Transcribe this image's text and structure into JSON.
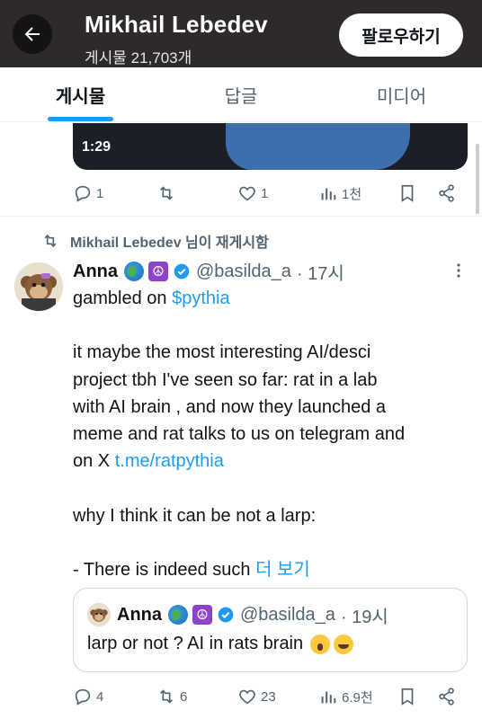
{
  "header": {
    "back_icon": "arrow-left-icon",
    "name": "Mikhail Lebedev",
    "post_count": "게시물 21,703개",
    "follow_label": "팔로우하기"
  },
  "tabs": [
    {
      "label": "게시물",
      "active": true
    },
    {
      "label": "답글",
      "active": false
    },
    {
      "label": "미디어",
      "active": false
    }
  ],
  "prev_post": {
    "video_duration": "1:29",
    "actions": {
      "replies": "1",
      "reposts": "",
      "likes": "1",
      "views": "1천"
    }
  },
  "repost_label": "Mikhail Lebedev 님이 재게시함",
  "tweet": {
    "author": "Anna",
    "author_emojis": [
      "globe-icon",
      "peace-icon"
    ],
    "handle": "@basilda_a",
    "time": "· 17시",
    "lines": {
      "l1_text": "gambled on ",
      "l1_link": "$pythia",
      "l2": "it maybe the most interesting AI/desci",
      "l3": "project tbh I've seen so far: rat in a lab",
      "l4": "with AI brain , and now they launched a",
      "l5": "meme and  rat talks to us on telegram and",
      "l6_text": "on X ",
      "l6_link": "t.me/ratpythia",
      "l7": "why I think it can be not a larp:",
      "l8_text": "- There is indeed such ",
      "l8_more": "더 보기"
    },
    "quote": {
      "author": "Anna",
      "handle": "@basilda_a",
      "time": "· 19시",
      "text": "larp or not ? AI in rats brain"
    },
    "actions": {
      "replies": "4",
      "reposts": "6",
      "likes": "23",
      "views": "6.9천"
    }
  },
  "colors": {
    "accent": "#1d9bf0",
    "muted": "#536471",
    "header_bg": "#2d2a29"
  }
}
